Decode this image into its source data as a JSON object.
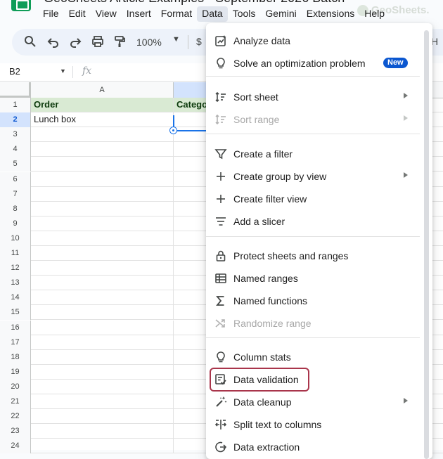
{
  "window": {
    "title": "GeoSheets Article Examples - September 2026 Batch",
    "watermark": "GeoSheets."
  },
  "menubar": {
    "items": [
      "File",
      "Edit",
      "View",
      "Insert",
      "Format",
      "Data",
      "Tools",
      "Gemini",
      "Extensions",
      "Help"
    ],
    "active": "Data"
  },
  "toolbar": {
    "zoom": "100%",
    "currency": "$",
    "trailing": "H",
    "icons": [
      "search-icon",
      "undo-icon",
      "redo-icon",
      "print-icon",
      "paint-format-icon"
    ]
  },
  "formula_bar": {
    "name_box": "B2",
    "fx": "fx"
  },
  "sheet": {
    "columns": [
      "A",
      ""
    ],
    "rows": [
      {
        "num": "1",
        "a": "Order",
        "b": "Catego"
      },
      {
        "num": "2",
        "a": "Lunch box",
        "b": ""
      },
      {
        "num": "3"
      },
      {
        "num": "4"
      },
      {
        "num": "5"
      },
      {
        "num": "6"
      },
      {
        "num": "7"
      },
      {
        "num": "8"
      },
      {
        "num": "9"
      },
      {
        "num": "10"
      },
      {
        "num": "11"
      },
      {
        "num": "12"
      },
      {
        "num": "13"
      },
      {
        "num": "14"
      },
      {
        "num": "15"
      },
      {
        "num": "16"
      },
      {
        "num": "17"
      },
      {
        "num": "18"
      },
      {
        "num": "19"
      },
      {
        "num": "20"
      },
      {
        "num": "21"
      },
      {
        "num": "22"
      },
      {
        "num": "23"
      },
      {
        "num": "24"
      }
    ],
    "selected_row": "2"
  },
  "data_menu": {
    "items": [
      {
        "label": "Analyze data",
        "icon": "analyze-data-icon"
      },
      {
        "label": "Solve an optimization problem",
        "icon": "lightbulb-icon",
        "badge": "New"
      },
      {
        "label": "Sort sheet",
        "icon": "sort-icon",
        "submenu": true
      },
      {
        "label": "Sort range",
        "icon": "sort-icon",
        "submenu": true,
        "disabled": true
      },
      {
        "label": "Create a filter",
        "icon": "filter-icon"
      },
      {
        "label": "Create group by view",
        "icon": "plus-icon",
        "submenu": true
      },
      {
        "label": "Create filter view",
        "icon": "plus-icon"
      },
      {
        "label": "Add a slicer",
        "icon": "slicer-icon"
      },
      {
        "label": "Protect sheets and ranges",
        "icon": "lock-icon"
      },
      {
        "label": "Named ranges",
        "icon": "table-icon"
      },
      {
        "label": "Named functions",
        "icon": "sigma-icon"
      },
      {
        "label": "Randomize range",
        "icon": "shuffle-icon",
        "disabled": true
      },
      {
        "label": "Column stats",
        "icon": "lightbulb-icon"
      },
      {
        "label": "Data validation",
        "icon": "data-validation-icon",
        "highlighted": true
      },
      {
        "label": "Data cleanup",
        "icon": "magic-wand-icon",
        "submenu": true
      },
      {
        "label": "Split text to columns",
        "icon": "split-columns-icon"
      },
      {
        "label": "Data extraction",
        "icon": "data-extraction-icon"
      }
    ]
  },
  "colors": {
    "accent": "#0b57d0",
    "header_fill": "#d9ead3",
    "highlight_border": "#a9354b"
  }
}
